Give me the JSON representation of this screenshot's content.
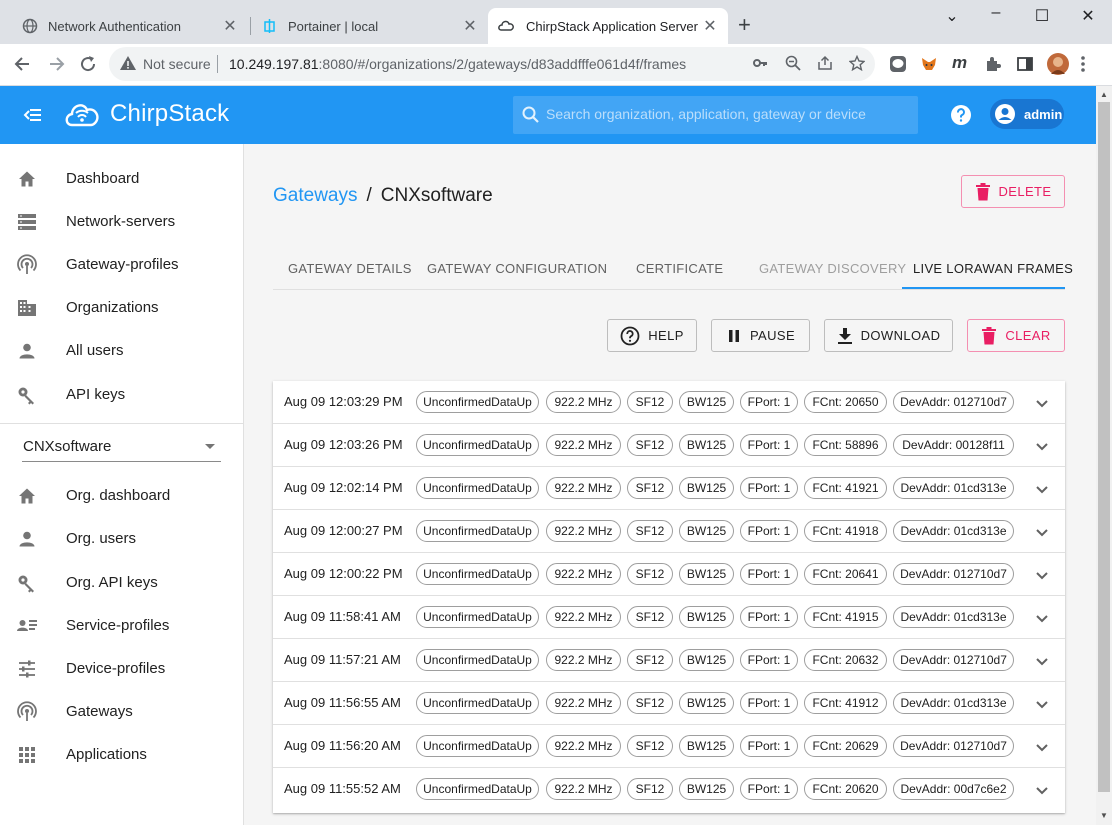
{
  "browser": {
    "tabs": [
      {
        "title": "Network Authentication",
        "icon": "globe-icon"
      },
      {
        "title": "Portainer | local",
        "icon": "portainer-icon"
      },
      {
        "title": "ChirpStack Application Server",
        "icon": "chirpstack-icon",
        "active": true
      }
    ],
    "security_label": "Not secure",
    "url_host": "10.249.197.81",
    "url_rest": ":8080/#/organizations/2/gateways/d83addfffe061d4f/frames"
  },
  "app": {
    "logo_text": "ChirpStack",
    "search_placeholder": "Search organization, application, gateway or device",
    "user_name": "admin",
    "brand_color": "#2196f3"
  },
  "sidebar": {
    "items": [
      {
        "label": "Dashboard",
        "icon": "home-icon"
      },
      {
        "label": "Network-servers",
        "icon": "server-icon"
      },
      {
        "label": "Gateway-profiles",
        "icon": "antenna-icon"
      },
      {
        "label": "Organizations",
        "icon": "building-icon"
      },
      {
        "label": "All users",
        "icon": "person-icon"
      },
      {
        "label": "API keys",
        "icon": "key-icon"
      }
    ],
    "org_selected": "CNXsoftware",
    "org_items": [
      {
        "label": "Org. dashboard",
        "icon": "home-icon"
      },
      {
        "label": "Org. users",
        "icon": "person-icon"
      },
      {
        "label": "Org. API keys",
        "icon": "key-icon"
      },
      {
        "label": "Service-profiles",
        "icon": "account-details-icon"
      },
      {
        "label": "Device-profiles",
        "icon": "tune-icon"
      },
      {
        "label": "Gateways",
        "icon": "antenna-icon"
      },
      {
        "label": "Applications",
        "icon": "apps-icon"
      }
    ]
  },
  "page": {
    "breadcrumb_link": "Gateways",
    "breadcrumb_sep": "/",
    "breadcrumb_current": "CNXsoftware",
    "delete_label": "DELETE",
    "tabs": [
      "GATEWAY DETAILS",
      "GATEWAY CONFIGURATION",
      "CERTIFICATE",
      "GATEWAY DISCOVERY",
      "LIVE LORAWAN FRAMES"
    ],
    "active_tab": "LIVE LORAWAN FRAMES",
    "actions": {
      "help": "HELP",
      "pause": "PAUSE",
      "download": "DOWNLOAD",
      "clear": "CLEAR"
    }
  },
  "frames": [
    {
      "time": "Aug 09 12:03:29 PM",
      "type": "UnconfirmedDataUp",
      "freq": "922.2 MHz",
      "sf": "SF12",
      "bw": "BW125",
      "fport": "FPort: 1",
      "fcnt": "FCnt: 20650",
      "devaddr": "DevAddr: 012710d7"
    },
    {
      "time": "Aug 09 12:03:26 PM",
      "type": "UnconfirmedDataUp",
      "freq": "922.2 MHz",
      "sf": "SF12",
      "bw": "BW125",
      "fport": "FPort: 1",
      "fcnt": "FCnt: 58896",
      "devaddr": "DevAddr: 00128f11"
    },
    {
      "time": "Aug 09 12:02:14 PM",
      "type": "UnconfirmedDataUp",
      "freq": "922.2 MHz",
      "sf": "SF12",
      "bw": "BW125",
      "fport": "FPort: 1",
      "fcnt": "FCnt: 41921",
      "devaddr": "DevAddr: 01cd313e"
    },
    {
      "time": "Aug 09 12:00:27 PM",
      "type": "UnconfirmedDataUp",
      "freq": "922.2 MHz",
      "sf": "SF12",
      "bw": "BW125",
      "fport": "FPort: 1",
      "fcnt": "FCnt: 41918",
      "devaddr": "DevAddr: 01cd313e"
    },
    {
      "time": "Aug 09 12:00:22 PM",
      "type": "UnconfirmedDataUp",
      "freq": "922.2 MHz",
      "sf": "SF12",
      "bw": "BW125",
      "fport": "FPort: 1",
      "fcnt": "FCnt: 20641",
      "devaddr": "DevAddr: 012710d7"
    },
    {
      "time": "Aug 09 11:58:41 AM",
      "type": "UnconfirmedDataUp",
      "freq": "922.2 MHz",
      "sf": "SF12",
      "bw": "BW125",
      "fport": "FPort: 1",
      "fcnt": "FCnt: 41915",
      "devaddr": "DevAddr: 01cd313e"
    },
    {
      "time": "Aug 09 11:57:21 AM",
      "type": "UnconfirmedDataUp",
      "freq": "922.2 MHz",
      "sf": "SF12",
      "bw": "BW125",
      "fport": "FPort: 1",
      "fcnt": "FCnt: 20632",
      "devaddr": "DevAddr: 012710d7"
    },
    {
      "time": "Aug 09 11:56:55 AM",
      "type": "UnconfirmedDataUp",
      "freq": "922.2 MHz",
      "sf": "SF12",
      "bw": "BW125",
      "fport": "FPort: 1",
      "fcnt": "FCnt: 41912",
      "devaddr": "DevAddr: 01cd313e"
    },
    {
      "time": "Aug 09 11:56:20 AM",
      "type": "UnconfirmedDataUp",
      "freq": "922.2 MHz",
      "sf": "SF12",
      "bw": "BW125",
      "fport": "FPort: 1",
      "fcnt": "FCnt: 20629",
      "devaddr": "DevAddr: 012710d7"
    },
    {
      "time": "Aug 09 11:55:52 AM",
      "type": "UnconfirmedDataUp",
      "freq": "922.2 MHz",
      "sf": "SF12",
      "bw": "BW125",
      "fport": "FPort: 1",
      "fcnt": "FCnt: 20620",
      "devaddr": "DevAddr: 00d7c6e2"
    }
  ]
}
